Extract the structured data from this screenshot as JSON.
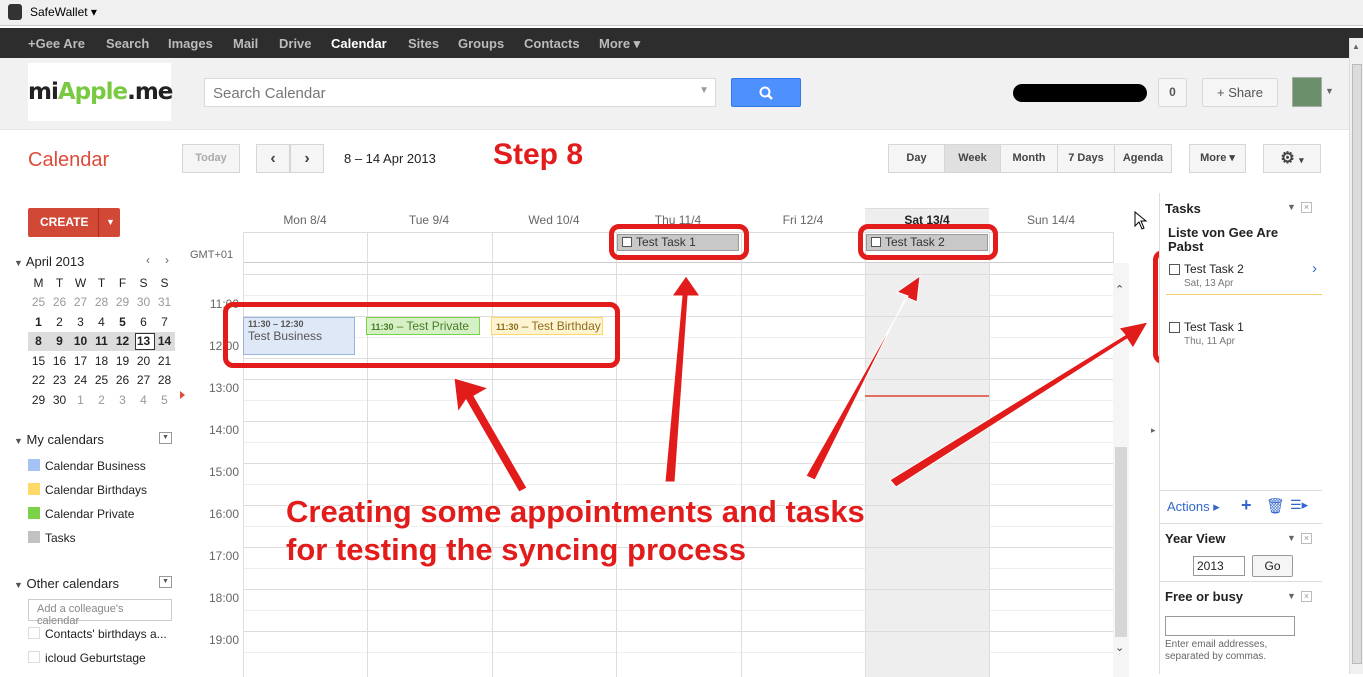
{
  "safewallet": {
    "label": "SafeWallet"
  },
  "gbar": {
    "items": [
      "+Gee Are",
      "Search",
      "Images",
      "Mail",
      "Drive",
      "Calendar",
      "Sites",
      "Groups",
      "Contacts",
      "More"
    ]
  },
  "logo": {
    "text_a": "mi",
    "text_g": "Apple",
    "text_b": ".me"
  },
  "search": {
    "placeholder": "Search Calendar"
  },
  "header": {
    "count": "0",
    "share": "+ Share"
  },
  "cal": {
    "title": "Calendar",
    "today": "Today",
    "range": "8 – 14 Apr 2013",
    "views": [
      "Day",
      "Week",
      "Month",
      "7 Days",
      "Agenda"
    ],
    "more": "More",
    "step": "Step 8"
  },
  "create": "CREATE",
  "mini": {
    "month": "April 2013",
    "dow": [
      "M",
      "T",
      "W",
      "T",
      "F",
      "S",
      "S"
    ],
    "weeks": [
      [
        "25",
        "26",
        "27",
        "28",
        "29",
        "30",
        "31"
      ],
      [
        "1",
        "2",
        "3",
        "4",
        "5",
        "6",
        "7"
      ],
      [
        "8",
        "9",
        "10",
        "11",
        "12",
        "13",
        "14"
      ],
      [
        "15",
        "16",
        "17",
        "18",
        "19",
        "20",
        "21"
      ],
      [
        "22",
        "23",
        "24",
        "25",
        "26",
        "27",
        "28"
      ],
      [
        "29",
        "30",
        "1",
        "2",
        "3",
        "4",
        "5"
      ]
    ]
  },
  "mycals": {
    "title": "My calendars",
    "items": [
      {
        "label": "Calendar Business",
        "color": "#a4c2f4"
      },
      {
        "label": "Calendar Birthdays",
        "color": "#ffd966"
      },
      {
        "label": "Calendar Private",
        "color": "#7bd148"
      },
      {
        "label": "Tasks",
        "color": "#c2c2c2"
      }
    ]
  },
  "othercals": {
    "title": "Other calendars",
    "placeholder": "Add a colleague's calendar",
    "items": [
      "Contacts' birthdays a...",
      "icloud Geburtstage"
    ]
  },
  "grid": {
    "tz": "GMT+01",
    "days": [
      "Mon 8/4",
      "Tue 9/4",
      "Wed 10/4",
      "Thu 11/4",
      "Fri 12/4",
      "Sat 13/4",
      "Sun 14/4"
    ],
    "hours": [
      "11:00",
      "12:00",
      "13:00",
      "14:00",
      "15:00",
      "16:00",
      "17:00",
      "18:00",
      "19:00"
    ]
  },
  "events": {
    "business_time": "11:30 – 12:30",
    "business_title": "Test Business",
    "private_time": "11:30",
    "private_title": "– Test Private",
    "birthday_time": "11:30",
    "birthday_title": "– Test Birthday",
    "task1": "Test Task 1",
    "task2": "Test Task 2"
  },
  "annotation": {
    "line1": "Creating some appointments and tasks",
    "line2": "for testing the syncing process"
  },
  "tasks": {
    "title": "Tasks",
    "list": "Liste von Gee Are Pabst",
    "items": [
      {
        "title": "Test Task 2",
        "date": "Sat, 13 Apr"
      },
      {
        "title": "Test Task 1",
        "date": "Thu, 11 Apr"
      }
    ],
    "actions": "Actions ▸"
  },
  "yearview": {
    "title": "Year View",
    "year": "2013",
    "go": "Go"
  },
  "freebusy": {
    "title": "Free or busy",
    "hint": "Enter email addresses, separated by commas."
  }
}
